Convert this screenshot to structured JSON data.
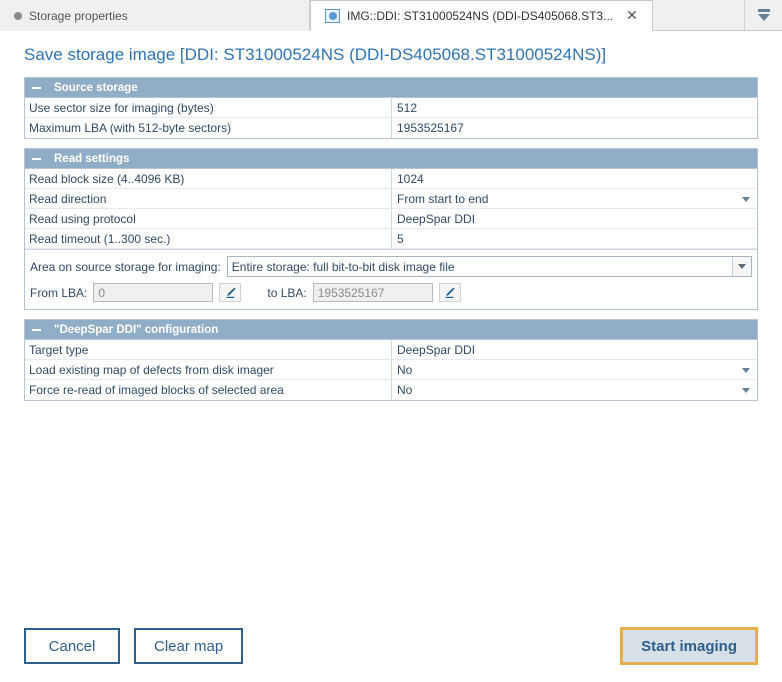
{
  "tabs": [
    {
      "label": "Storage properties",
      "icon": "dot-icon",
      "active": false,
      "closable": false
    },
    {
      "label": "IMG::DDI: ST31000524NS (DDI-DS405068.ST3...",
      "icon": "disk-icon",
      "active": true,
      "closable": true,
      "close_glyph": "✕"
    }
  ],
  "tablist_button": {
    "name": "tab-list-dropdown"
  },
  "page_title": "Save storage image [DDI: ST31000524NS (DDI-DS405068.ST31000524NS)]",
  "sections": [
    {
      "id": "source-storage",
      "header": "Source storage",
      "collapse_glyph": "−",
      "rows": [
        {
          "label": "Use sector size for imaging (bytes)",
          "value": "512",
          "dropdown": false
        },
        {
          "label": "Maximum LBA (with 512-byte sectors)",
          "value": "1953525167",
          "dropdown": false
        }
      ]
    },
    {
      "id": "read-settings",
      "header": "Read settings",
      "collapse_glyph": "−",
      "rows": [
        {
          "label": "Read block size (4..4096 KB)",
          "value": "1024",
          "dropdown": false
        },
        {
          "label": "Read direction",
          "value": "From start to end",
          "dropdown": true
        },
        {
          "label": "Read using protocol",
          "value": "DeepSpar DDI",
          "dropdown": false
        },
        {
          "label": "Read timeout (1..300 sec.)",
          "value": "5",
          "dropdown": false
        }
      ],
      "area": {
        "label": "Area on source storage for imaging:",
        "combo_value": "Entire storage: full bit-to-bit disk image file",
        "from_label": "From LBA:",
        "from_value": "0",
        "to_label": "to LBA:",
        "to_value": "1953525167",
        "edit_icon": "pencil-icon"
      }
    },
    {
      "id": "deepspar-ddi-configuration",
      "header": "\"DeepSpar DDI\" configuration",
      "collapse_glyph": "−",
      "rows": [
        {
          "label": "Target type",
          "value": "DeepSpar DDI",
          "dropdown": false
        },
        {
          "label": "Load existing map of defects from disk imager",
          "value": "No",
          "dropdown": true
        },
        {
          "label": "Force re-read of imaged blocks of selected area",
          "value": "No",
          "dropdown": true
        }
      ]
    }
  ],
  "footer": {
    "cancel_label": "Cancel",
    "clear_map_label": "Clear map",
    "start_imaging_label": "Start imaging"
  },
  "colors": {
    "accent_title": "#2e74b5",
    "section_header_bg": "#8fadc6",
    "panel_border": "#b6c4d2",
    "button_border": "#2f5f8f",
    "primary_border": "#e3b04b",
    "primary_bg": "#d7dfe7"
  }
}
